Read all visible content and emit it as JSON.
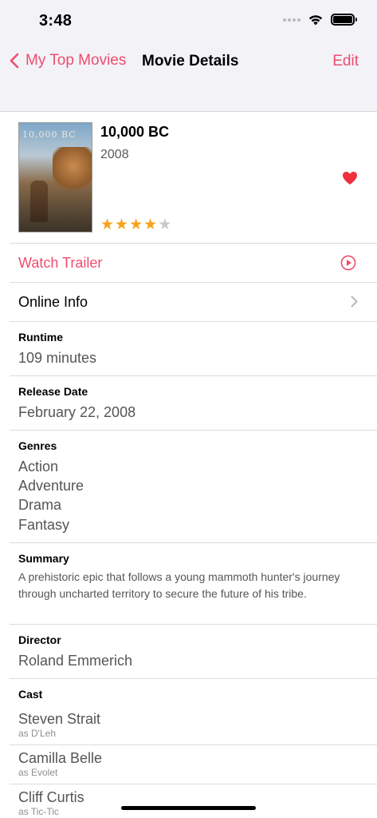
{
  "status_bar": {
    "time": "3:48"
  },
  "nav": {
    "back_label": "My Top Movies",
    "title": "Movie Details",
    "edit_label": "Edit"
  },
  "movie": {
    "poster_text": "10,000 BC",
    "title": "10,000 BC",
    "year": "2008",
    "rating": 4,
    "rating_max": 5,
    "favorite": true
  },
  "actions": {
    "watch_trailer": "Watch Trailer",
    "online_info": "Online Info"
  },
  "runtime": {
    "label": "Runtime",
    "value": "109 minutes"
  },
  "release": {
    "label": "Release Date",
    "value": "February 22, 2008"
  },
  "genres": {
    "label": "Genres",
    "items": [
      "Action",
      "Adventure",
      "Drama",
      "Fantasy"
    ]
  },
  "summary": {
    "label": "Summary",
    "text": "A prehistoric epic that follows a young mammoth hunter's journey through uncharted territory to secure the future of his tribe."
  },
  "director": {
    "label": "Director",
    "value": "Roland Emmerich"
  },
  "cast": {
    "label": "Cast",
    "members": [
      {
        "name": "Steven Strait",
        "role": "as D'Leh"
      },
      {
        "name": "Camilla Belle",
        "role": "as Evolet"
      },
      {
        "name": "Cliff Curtis",
        "role": "as Tic-Tic"
      }
    ]
  },
  "colors": {
    "accent": "#ee4d6e",
    "heart": "#f0303c",
    "star": "#f7a21b",
    "nav_background": "#f2f2f7"
  }
}
